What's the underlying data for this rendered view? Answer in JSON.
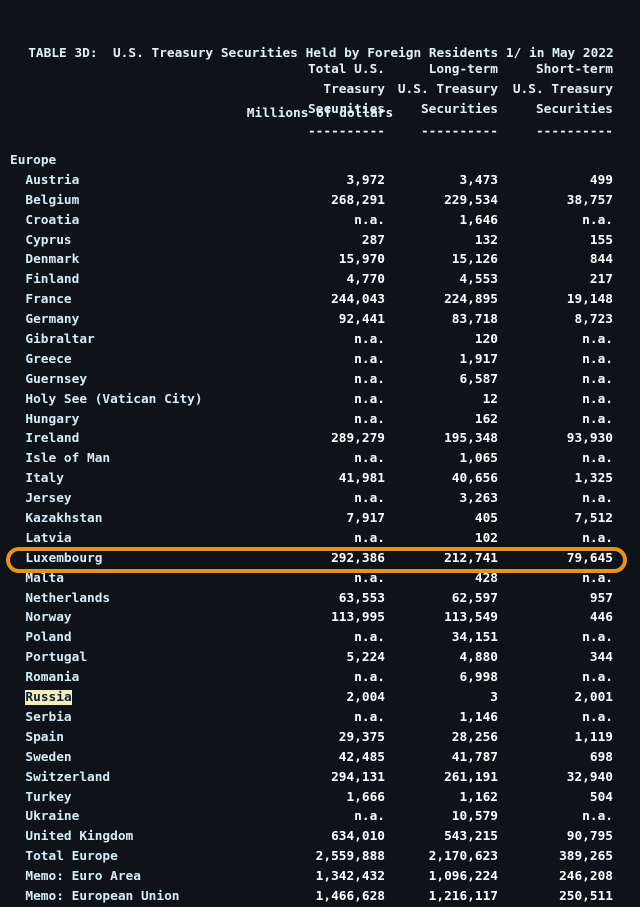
{
  "window": {
    "background_color": "#0d1318",
    "text_color": "#d6ecfa",
    "number_color": "#ffffff",
    "highlight_box_color": "#e8921c",
    "selection_background": "#f2eec0",
    "selection_text_color": "#11212c"
  },
  "title": {
    "line1": "TABLE 3D:  U.S. Treasury Securities Held by Foreign Residents 1/ in May 2022",
    "line2": "Millions of dollars"
  },
  "columns": [
    {
      "id": "total",
      "lines": [
        "Total U.S.",
        "Treasury",
        "Securities"
      ],
      "rule": "----------"
    },
    {
      "id": "long_term",
      "lines": [
        "Long-term",
        "U.S. Treasury",
        "Securities"
      ],
      "rule": "----------"
    },
    {
      "id": "short_term",
      "lines": [
        "Short-term",
        "U.S. Treasury",
        "Securities"
      ],
      "rule": "----------"
    }
  ],
  "rows": [
    {
      "label": "Europe",
      "indent": false,
      "group": true,
      "values": [
        "",
        "",
        ""
      ]
    },
    {
      "label": "Austria",
      "indent": true,
      "values": [
        "3,972",
        "3,473",
        "499"
      ]
    },
    {
      "label": "Belgium",
      "indent": true,
      "values": [
        "268,291",
        "229,534",
        "38,757"
      ]
    },
    {
      "label": "Croatia",
      "indent": true,
      "values": [
        "n.a.",
        "1,646",
        "n.a."
      ]
    },
    {
      "label": "Cyprus",
      "indent": true,
      "values": [
        "287",
        "132",
        "155"
      ]
    },
    {
      "label": "Denmark",
      "indent": true,
      "values": [
        "15,970",
        "15,126",
        "844"
      ]
    },
    {
      "label": "Finland",
      "indent": true,
      "values": [
        "4,770",
        "4,553",
        "217"
      ]
    },
    {
      "label": "France",
      "indent": true,
      "values": [
        "244,043",
        "224,895",
        "19,148"
      ]
    },
    {
      "label": "Germany",
      "indent": true,
      "values": [
        "92,441",
        "83,718",
        "8,723"
      ]
    },
    {
      "label": "Gibraltar",
      "indent": true,
      "values": [
        "n.a.",
        "120",
        "n.a."
      ]
    },
    {
      "label": "Greece",
      "indent": true,
      "values": [
        "n.a.",
        "1,917",
        "n.a."
      ]
    },
    {
      "label": "Guernsey",
      "indent": true,
      "values": [
        "n.a.",
        "6,587",
        "n.a."
      ]
    },
    {
      "label": "Holy See (Vatican City)",
      "indent": true,
      "values": [
        "n.a.",
        "12",
        "n.a."
      ]
    },
    {
      "label": "Hungary",
      "indent": true,
      "values": [
        "n.a.",
        "162",
        "n.a."
      ]
    },
    {
      "label": "Ireland",
      "indent": true,
      "values": [
        "289,279",
        "195,348",
        "93,930"
      ]
    },
    {
      "label": "Isle of Man",
      "indent": true,
      "values": [
        "n.a.",
        "1,065",
        "n.a."
      ]
    },
    {
      "label": "Italy",
      "indent": true,
      "values": [
        "41,981",
        "40,656",
        "1,325"
      ]
    },
    {
      "label": "Jersey",
      "indent": true,
      "values": [
        "n.a.",
        "3,263",
        "n.a."
      ]
    },
    {
      "label": "Kazakhstan",
      "indent": true,
      "values": [
        "7,917",
        "405",
        "7,512"
      ]
    },
    {
      "label": "Latvia",
      "indent": true,
      "values": [
        "n.a.",
        "102",
        "n.a."
      ]
    },
    {
      "label": "Luxembourg",
      "indent": true,
      "values": [
        "292,386",
        "212,741",
        "79,645"
      ]
    },
    {
      "label": "Malta",
      "indent": true,
      "values": [
        "n.a.",
        "428",
        "n.a."
      ]
    },
    {
      "label": "Netherlands",
      "indent": true,
      "values": [
        "63,553",
        "62,597",
        "957"
      ]
    },
    {
      "label": "Norway",
      "indent": true,
      "values": [
        "113,995",
        "113,549",
        "446"
      ]
    },
    {
      "label": "Poland",
      "indent": true,
      "values": [
        "n.a.",
        "34,151",
        "n.a."
      ]
    },
    {
      "label": "Portugal",
      "indent": true,
      "values": [
        "5,224",
        "4,880",
        "344"
      ]
    },
    {
      "label": "Romania",
      "indent": true,
      "values": [
        "n.a.",
        "6,998",
        "n.a."
      ]
    },
    {
      "label": "Russia",
      "indent": true,
      "selected": true,
      "values": [
        "2,004",
        "3",
        "2,001"
      ]
    },
    {
      "label": "Serbia",
      "indent": true,
      "values": [
        "n.a.",
        "1,146",
        "n.a."
      ]
    },
    {
      "label": "Spain",
      "indent": true,
      "values": [
        "29,375",
        "28,256",
        "1,119"
      ]
    },
    {
      "label": "Sweden",
      "indent": true,
      "values": [
        "42,485",
        "41,787",
        "698"
      ]
    },
    {
      "label": "Switzerland",
      "indent": true,
      "values": [
        "294,131",
        "261,191",
        "32,940"
      ]
    },
    {
      "label": "Turkey",
      "indent": true,
      "values": [
        "1,666",
        "1,162",
        "504"
      ]
    },
    {
      "label": "Ukraine",
      "indent": true,
      "values": [
        "n.a.",
        "10,579",
        "n.a."
      ]
    },
    {
      "label": "United Kingdom",
      "indent": true,
      "values": [
        "634,010",
        "543,215",
        "90,795"
      ]
    },
    {
      "label": "Total Europe",
      "indent": true,
      "values": [
        "2,559,888",
        "2,170,623",
        "389,265"
      ]
    },
    {
      "label": "Memo: Euro Area",
      "indent": true,
      "values": [
        "1,342,432",
        "1,096,224",
        "246,208"
      ]
    },
    {
      "label": "Memo: European Union",
      "indent": true,
      "values": [
        "1,466,628",
        "1,216,117",
        "250,511"
      ]
    }
  ],
  "annotation": {
    "type": "highlight-rectangle",
    "target_row_label": "Russia",
    "color": "#e8921c"
  }
}
